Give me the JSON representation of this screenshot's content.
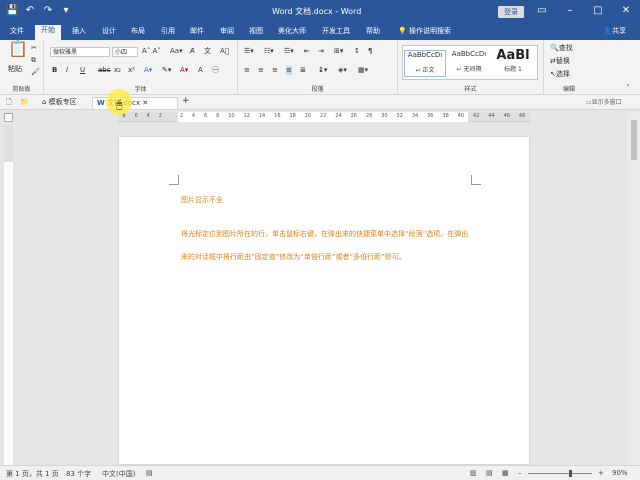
{
  "window": {
    "title": "Word 文档.docx  -  Word",
    "login": "登录"
  },
  "qat": {
    "save_icon": "save-icon",
    "undo_icon": "undo-icon",
    "redo_icon": "redo-icon",
    "customize_icon": "customize-icon"
  },
  "tabs": [
    "文件",
    "开始",
    "插入",
    "设计",
    "布局",
    "引用",
    "邮件",
    "审阅",
    "视图",
    "美化大师",
    "开发工具",
    "帮助",
    "操作说明搜索"
  ],
  "share": "共享",
  "ribbon": {
    "clipboard": {
      "paste": "粘贴",
      "label": "剪贴板"
    },
    "font": {
      "name": "微软雅黑",
      "size": "小四",
      "label": "字体",
      "buttons": [
        "B",
        "I",
        "U",
        "abc",
        "x₂",
        "x²"
      ]
    },
    "paragraph": {
      "label": "段落"
    },
    "styles": {
      "label": "样式",
      "items": [
        {
          "sample": "AaBbCcDı",
          "name": "↵ 正文"
        },
        {
          "sample": "AaBbCcDı",
          "name": "↵ 无间隔"
        },
        {
          "sample": "AaBl",
          "name": "标题 1"
        }
      ]
    },
    "editing": {
      "label": "编辑",
      "find": "查找",
      "replace": "替换",
      "select": "选择"
    }
  },
  "doctabs": {
    "template": "模板专区",
    "doc": "文档.docx",
    "multi": "显示多窗口"
  },
  "ruler": {
    "numbers": [
      "8",
      "6",
      "4",
      "2",
      "",
      "2",
      "4",
      "6",
      "8",
      "10",
      "12",
      "14",
      "16",
      "18",
      "20",
      "22",
      "24",
      "26",
      "28",
      "30",
      "32",
      "34",
      "36",
      "38",
      "40",
      "42",
      "44",
      "46",
      "48"
    ]
  },
  "document": {
    "heading": "图片显示不全",
    "paragraph": "将光标定位到图片所在的行，单击鼠标右键，在弹出来的快捷菜单中选择“段落”选项。在弹出来的对话框中将行距由“固定值”修改为“单倍行距”或者“多倍行距”即可。"
  },
  "status": {
    "page": "第 1 页，共 1 页",
    "words": "83 个字",
    "lang": "中文(中国)",
    "zoom": "90%",
    "zoom_level": 0.9
  },
  "colors": {
    "brand": "#2b579a",
    "text_orange": "#d4831f"
  }
}
